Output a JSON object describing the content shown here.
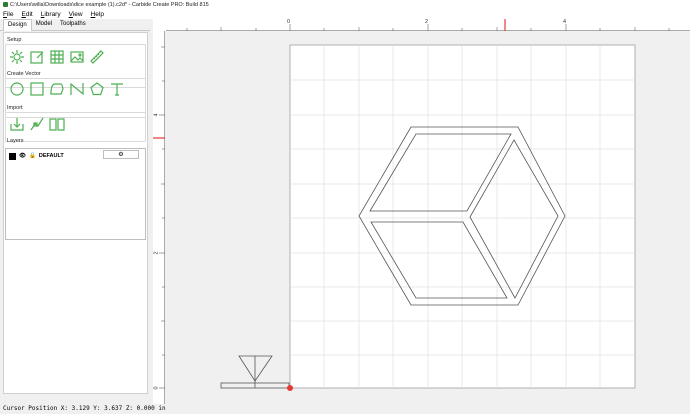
{
  "window": {
    "title": "C:\\Users\\willa\\Downloads\\dice example (1).c2d* - Carbide Create PRO: Build 815"
  },
  "menu": [
    "File",
    "Edit",
    "Library",
    "View",
    "Help"
  ],
  "tabs": [
    {
      "label": "Design",
      "active": true
    },
    {
      "label": "Model",
      "active": false
    },
    {
      "label": "Toolpaths",
      "active": false
    }
  ],
  "sections": {
    "setup": "Setup",
    "create_vector": "Create Vector",
    "import": "Import",
    "layers": "Layers"
  },
  "icons": {
    "setup": [
      "job-setup-icon",
      "edit-icon",
      "grid-icon",
      "image-icon",
      "measure-icon"
    ],
    "create_vector": [
      "circle-icon",
      "rectangle-icon",
      "polygon-icon",
      "curve-icon",
      "pentagon-icon",
      "text-icon"
    ],
    "import": [
      "import-icon",
      "import-vector-icon",
      "library-book-icon"
    ]
  },
  "layers": [
    {
      "name": "DEFAULT",
      "color": "#000000",
      "visible": true,
      "locked": true
    }
  ],
  "rulers": {
    "x_labels": [
      "0",
      "2",
      "4"
    ],
    "y_labels": [
      "4",
      "2",
      "0"
    ]
  },
  "status": {
    "cursor_position": "Cursor Position X: 3.129 Y: 3.637 Z: 0.000 in"
  },
  "colors": {
    "accent_green": "#4caf50",
    "marker_red": "#e53935"
  }
}
